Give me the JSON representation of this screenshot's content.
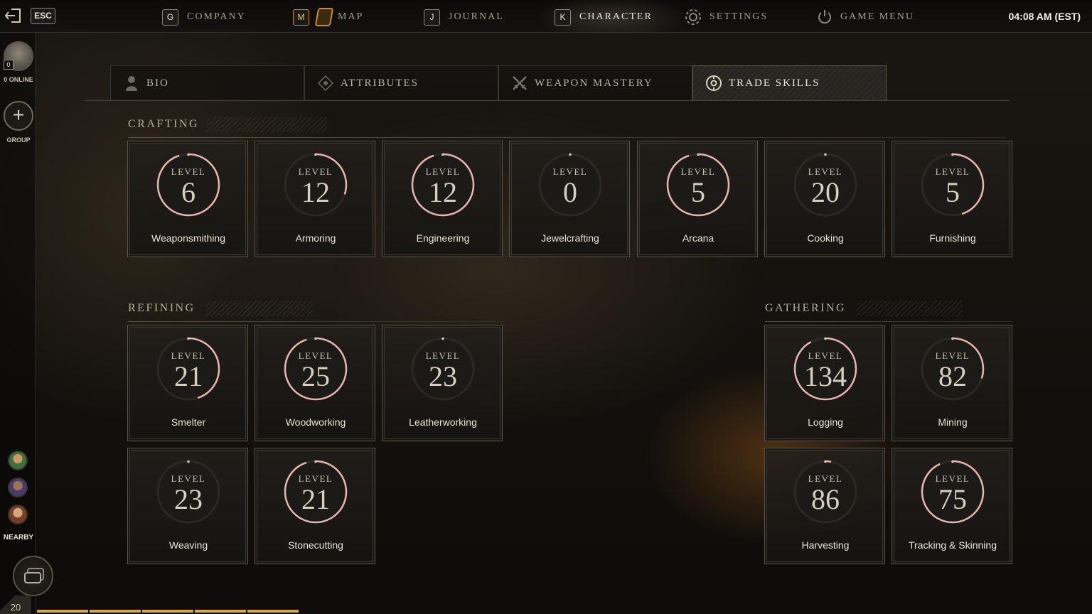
{
  "topbar": {
    "esc_label": "ESC",
    "nav": [
      {
        "key": "G",
        "label": "COMPANY"
      },
      {
        "key": "M",
        "label": "MAP"
      },
      {
        "key": "J",
        "label": "JOURNAL"
      },
      {
        "key": "K",
        "label": "CHARACTER"
      },
      {
        "key": "",
        "label": "SETTINGS"
      },
      {
        "key": "",
        "label": "GAME MENU"
      }
    ],
    "clock": "04:08 AM  (EST)"
  },
  "sidebar": {
    "online_count": "0",
    "online_label": "0 ONLINE",
    "group_label": "GROUP",
    "nearby_label": "NEARBY",
    "player_level": "20",
    "xp_progress": 0.9
  },
  "tabs": [
    {
      "label": "BIO",
      "icon": "person-icon"
    },
    {
      "label": "ATTRIBUTES",
      "icon": "attribute-diamond-icon"
    },
    {
      "label": "WEAPON MASTERY",
      "icon": "crossed-swords-icon"
    },
    {
      "label": "TRADE SKILLS",
      "icon": "trade-skills-icon",
      "active": true
    }
  ],
  "level_word": "LEVEL",
  "sections": {
    "crafting": {
      "title": "CRAFTING",
      "skills": [
        {
          "name": "Weaponsmithing",
          "level": "6",
          "progress": 0.95
        },
        {
          "name": "Armoring",
          "level": "12",
          "progress": 0.3
        },
        {
          "name": "Engineering",
          "level": "12",
          "progress": 0.95
        },
        {
          "name": "Jewelcrafting",
          "level": "0",
          "progress": 0.0
        },
        {
          "name": "Arcana",
          "level": "5",
          "progress": 0.95
        },
        {
          "name": "Cooking",
          "level": "20",
          "progress": 0.0
        },
        {
          "name": "Furnishing",
          "level": "5",
          "progress": 0.45
        }
      ]
    },
    "refining": {
      "title": "REFINING",
      "skills": [
        {
          "name": "Smelter",
          "level": "21",
          "progress": 0.45
        },
        {
          "name": "Woodworking",
          "level": "25",
          "progress": 0.95
        },
        {
          "name": "Leatherworking",
          "level": "23",
          "progress": 0.0
        },
        {
          "name": "Weaving",
          "level": "23",
          "progress": 0.0
        },
        {
          "name": "Stonecutting",
          "level": "21",
          "progress": 0.95
        }
      ]
    },
    "gathering": {
      "title": "GATHERING",
      "skills": [
        {
          "name": "Logging",
          "level": "134",
          "progress": 0.92
        },
        {
          "name": "Mining",
          "level": "82",
          "progress": 0.3
        },
        {
          "name": "Harvesting",
          "level": "86",
          "progress": 0.03
        },
        {
          "name": "Tracking & Skinning",
          "level": "75",
          "progress": 0.93
        }
      ]
    }
  },
  "colors": {
    "progress_ring": "#e7b4b0",
    "ring_track": "#2c2823",
    "accent_gold": "#c98c33"
  }
}
